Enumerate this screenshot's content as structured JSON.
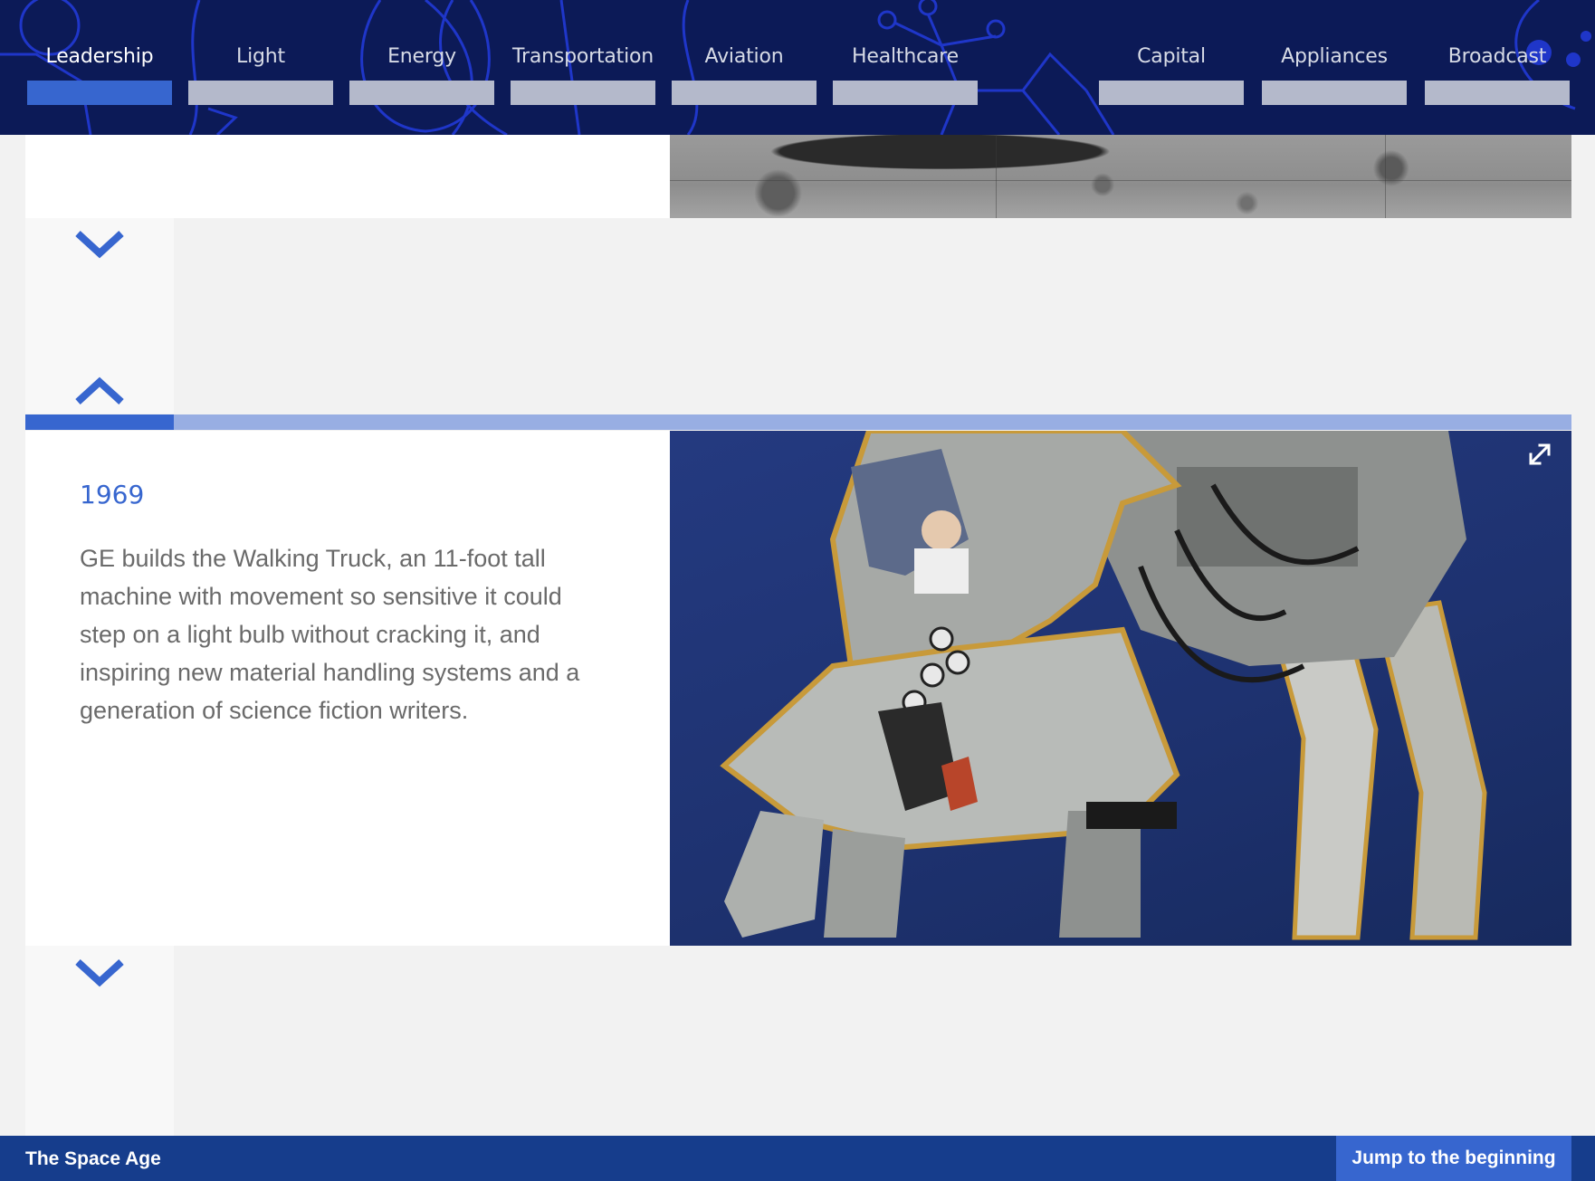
{
  "nav": {
    "items": [
      {
        "label": "Leadership",
        "active": true
      },
      {
        "label": "Light",
        "active": false
      },
      {
        "label": "Energy",
        "active": false
      },
      {
        "label": "Transportation",
        "active": false
      },
      {
        "label": "Aviation",
        "active": false
      },
      {
        "label": "Healthcare",
        "active": false
      },
      {
        "label": "Capital",
        "active": false
      },
      {
        "label": "Appliances",
        "active": false
      },
      {
        "label": "Broadcast",
        "active": false
      }
    ]
  },
  "entry": {
    "year": "1969",
    "description": "GE builds the Walking Truck, an 11-foot tall machine with movement so sensitive it could step on a light bulb without cracking it, and inspiring new material handling systems and a generation of science fiction writers."
  },
  "icons": {
    "scroll_down": "chevron-down-icon",
    "scroll_up": "chevron-up-icon",
    "expand": "expand-icon"
  },
  "footer": {
    "section_title": "The Space Age",
    "jump_label": "Jump to the beginning"
  },
  "colors": {
    "nav_bg": "#0c1a57",
    "accent": "#3766cf",
    "footer_bg": "#163d8c"
  }
}
